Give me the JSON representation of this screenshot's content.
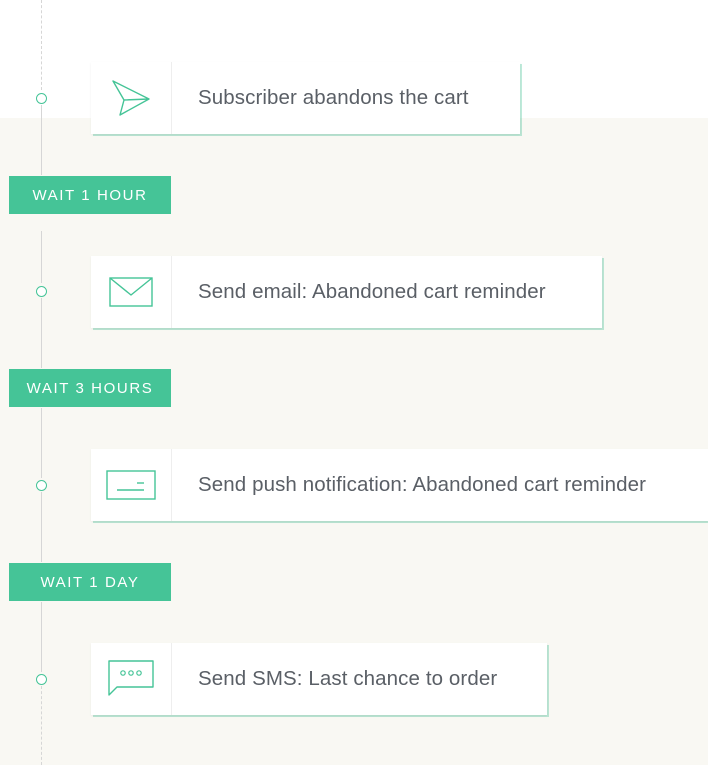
{
  "colors": {
    "accent": "#45c497",
    "text": "#5a5f66",
    "background_band": "#f9f8f3",
    "line": "#d6d6d6"
  },
  "steps": [
    {
      "icon": "paper-plane-icon",
      "label": "Subscriber abandons the cart"
    },
    {
      "icon": "envelope-icon",
      "label": "Send email: Abandoned cart reminder"
    },
    {
      "icon": "push-notification-icon",
      "label": "Send push notification: Abandoned cart reminder"
    },
    {
      "icon": "sms-bubble-icon",
      "label": "Send SMS: Last chance to order"
    }
  ],
  "waits": [
    {
      "label": "WAIT 1 HOUR"
    },
    {
      "label": "WAIT 3 HOURS"
    },
    {
      "label": "WAIT 1 DAY"
    }
  ]
}
